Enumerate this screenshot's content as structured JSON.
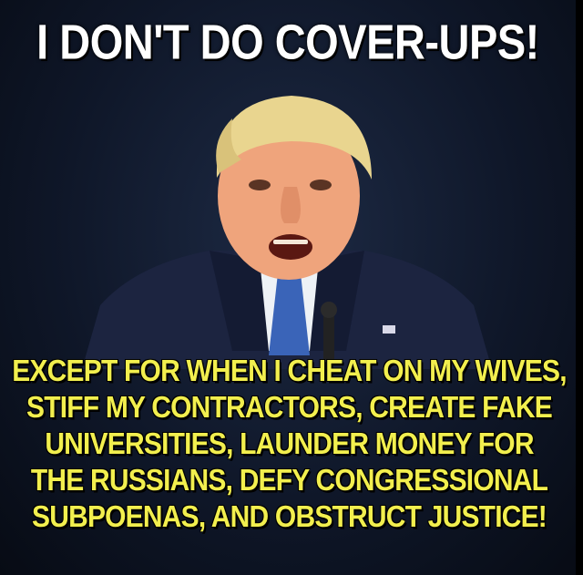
{
  "meme": {
    "headline": "I DON'T DO COVER-UPS!",
    "caption_lines": [
      "EXCEPT FOR WHEN I CHEAT ON MY WIVES,",
      "STIFF MY CONTRACTORS, CREATE FAKE",
      "UNIVERSITIES, LAUNDER MONEY FOR",
      "THE RUSSIANS, DEFY CONGRESSIONAL",
      "SUBPOENAS, AND OBSTRUCT JUSTICE!"
    ],
    "colors": {
      "headline": "#ffffff",
      "caption": "#f2ef4e",
      "background": "#0f1729"
    }
  }
}
